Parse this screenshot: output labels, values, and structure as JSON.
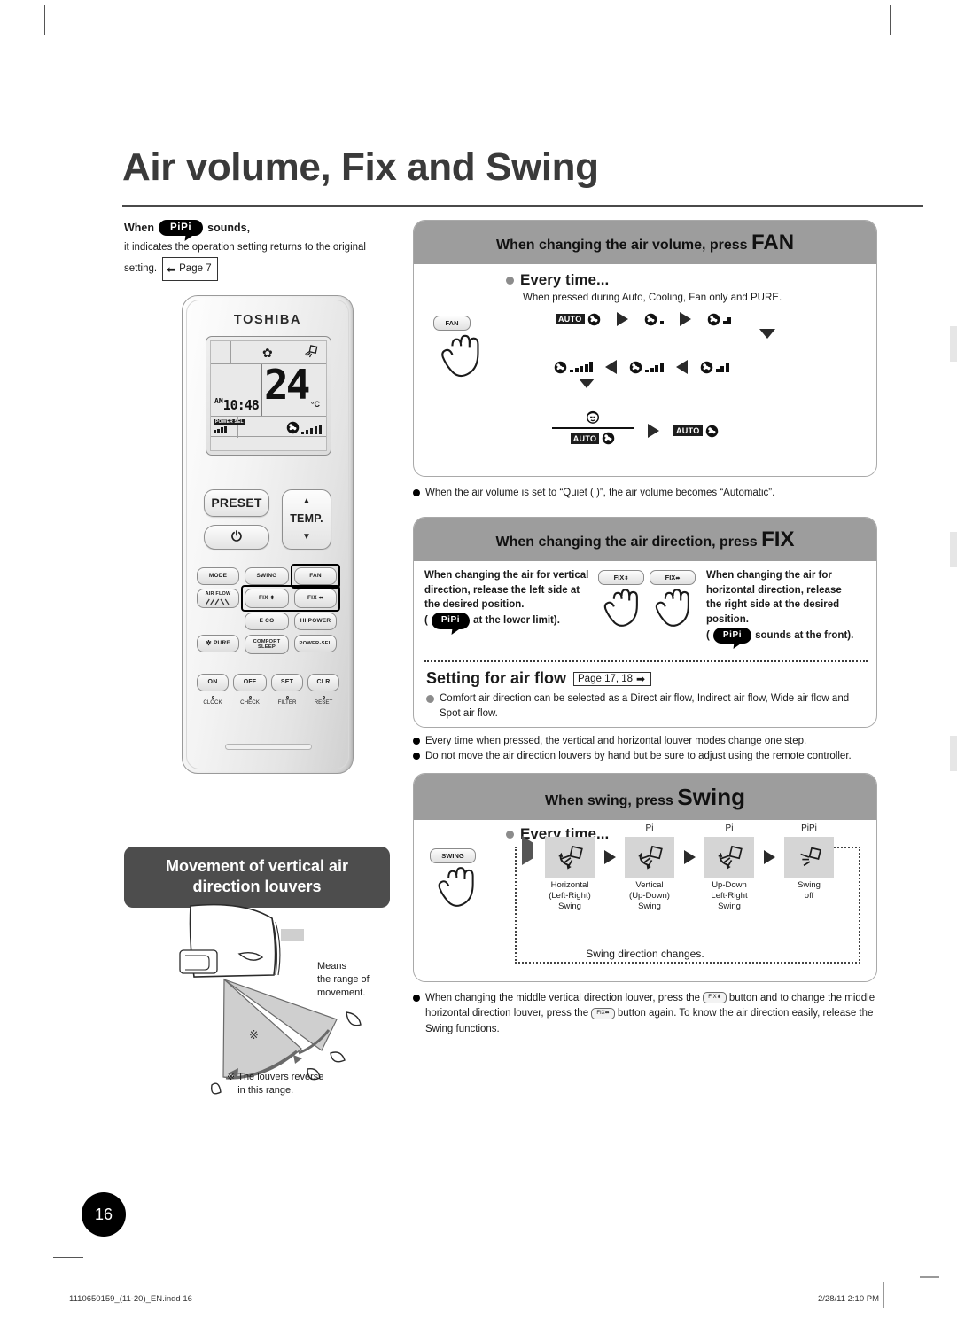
{
  "document": {
    "title": "Air volume, Fix and Swing",
    "page_number": "16",
    "footer_left": "1110650159_(11-20)_EN.indd   16",
    "footer_right": "2/28/11   2:10 PM"
  },
  "pipi_note": {
    "prefix": "When",
    "bubble": "PiPi",
    "suffix": "sounds,",
    "body": "it indicates the operation setting returns to the original",
    "body2": "setting.",
    "page_ref": "Page 7"
  },
  "remote": {
    "brand": "TOSHIBA",
    "lcd": {
      "temperature": "24",
      "unit": "°C",
      "am": "AM",
      "clock": "10:48",
      "power_sel": "POWER SEL"
    },
    "buttons": {
      "preset": "PRESET",
      "power_icon": "⏻",
      "temp": "TEMP.",
      "temp_up": "▲",
      "temp_down": "▼",
      "mode": "MODE",
      "swing": "SWING",
      "fan": "FAN",
      "air_flow": "AIR FLOW",
      "fix_vertical": "FIX",
      "fix_horizontal": "FIX",
      "eco": "E CO",
      "hi_power": "HI POWER",
      "pure": "PURE",
      "comfort_sleep": "COMFORT\nSLEEP",
      "power_sel": "POWER-SEL",
      "on": "ON",
      "off": "OFF",
      "set": "SET",
      "clr": "CLR",
      "clock": "CLOCK",
      "check": "CHECK",
      "filter": "FILTER",
      "reset": "RESET"
    }
  },
  "fan_section": {
    "heading_text": "When changing the air volume, press",
    "heading_key": "FAN",
    "every_time": "Every time...",
    "sub": "When pressed during Auto, Cooling, Fan only and PURE.",
    "button_label": "FAN",
    "auto_tag": "AUTO",
    "sequence_row1": [
      "AUTO",
      "1",
      "2"
    ],
    "sequence_row2": [
      "5",
      "4",
      "3"
    ],
    "sequence_row3": [
      "QUIET over AUTO",
      "AUTO"
    ],
    "note": "When the air volume is set to “Quiet (   )”, the air volume becomes “Automatic”."
  },
  "fix_section": {
    "heading_text": "When changing the air direction, press",
    "heading_key": "FIX",
    "left_text_1": "When changing the air for vertical",
    "left_text_2": "direction, release the left side at",
    "left_text_3": "the desired position.",
    "left_text_4_pre": "(",
    "left_text_4_bubble": "PiPi",
    "left_text_4_post": "at the lower limit).",
    "button_v": "FIX",
    "button_h": "FIX",
    "right_text_1": "When changing the air for",
    "right_text_2": "horizontal direction, release",
    "right_text_3": "the right side at the desired",
    "right_text_4": "position.",
    "right_text_5_pre": "(",
    "right_text_5_bubble": "PiPi",
    "right_text_5_post": "sounds at the front).",
    "airflow_title": "Setting for air flow",
    "airflow_page_ref": "Page 17, 18",
    "airflow_note_1": "Comfort air direction can be selected as a Direct air flow, Indirect air flow, Wide air flow and",
    "airflow_note_2": "Spot air flow."
  },
  "mid_notes": [
    "Every time when pressed, the vertical and horizontal louver modes change one step.",
    "Do not move the air direction louvers by hand but be sure to adjust using the remote controller."
  ],
  "swing_section": {
    "heading_text": "When swing, press",
    "heading_key": "Swing",
    "every_time": "Every time...",
    "button_label": "SWING",
    "steps": [
      {
        "sound": "",
        "label": "Horizontal\n(Left-Right)\nSwing"
      },
      {
        "sound": "Pi",
        "label": "Vertical\n(Up-Down)\nSwing"
      },
      {
        "sound": "Pi",
        "label": "Up-Down\nLeft-Right\nSwing"
      },
      {
        "sound": "PiPi",
        "label": "Swing\noff"
      }
    ],
    "caption": "Swing direction changes."
  },
  "bottom_note": {
    "part1": "When changing the middle vertical direction louver, press the",
    "part2": "button and to change the middle",
    "part3": "horizontal direction louver, press the",
    "part4": "button again. To know the air direction easily, release the",
    "part5": "Swing functions."
  },
  "movement": {
    "banner_line1": "Movement of vertical air",
    "banner_line2": "direction louvers",
    "legend_1": "Means",
    "legend_2": "the range of",
    "legend_3": "movement.",
    "reverse_mark": "※",
    "reverse_1": "The louvers reverse",
    "reverse_2": "in this range."
  },
  "colors": {
    "banner_grey": "#9d9d9d",
    "banner_dark": "#4d4d4d",
    "icon_box_grey": "#d5d5d5",
    "title_grey": "#3a3a3a"
  }
}
